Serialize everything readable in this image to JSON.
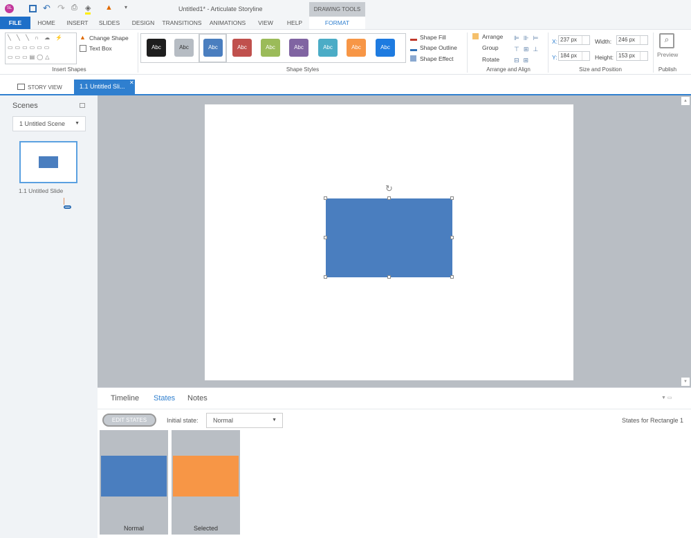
{
  "window": {
    "title": "Untitled1* -  Articulate Storyline",
    "logo": "SL",
    "contextual_group": "DRAWING TOOLS"
  },
  "tabs": [
    "FILE",
    "HOME",
    "INSERT",
    "SLIDES",
    "DESIGN",
    "TRANSITIONS",
    "ANIMATIONS",
    "VIEW",
    "HELP",
    "FORMAT"
  ],
  "ribbon": {
    "insert_shapes": {
      "label": "Insert Shapes",
      "change_shape": "Change Shape",
      "text_box": "Text Box"
    },
    "shape_styles": {
      "label": "Shape Styles",
      "swatch_text": "Abc",
      "swatches": [
        "#1e1e1e",
        "#b6bcc3",
        "#4a7ebf",
        "#c0504d",
        "#9bbb59",
        "#8064a2",
        "#4bacc6",
        "#f79646",
        "#1e7be0"
      ],
      "fill": "Shape Fill",
      "outline": "Shape Outline",
      "effect": "Shape Effect"
    },
    "arrange": {
      "label": "Arrange and Align",
      "arrange": "Arrange",
      "group": "Group",
      "rotate": "Rotate"
    },
    "size": {
      "label": "Size and Position",
      "x_label": "X:",
      "x": "237 px",
      "y_label": "Y:",
      "y": "184 px",
      "width_label": "Width:",
      "width": "246 px",
      "height_label": "Height:",
      "height": "153 px"
    },
    "publish": {
      "label": "Publish",
      "preview": "Preview"
    }
  },
  "doc_tabs": {
    "story_view": "STORY VIEW",
    "active": "1.1 Untitled Sli..."
  },
  "scenes": {
    "title": "Scenes",
    "selected": "1 Untitled Scene",
    "slide_label": "1.1 Untitled Slide"
  },
  "bottom": {
    "tabs": [
      "Timeline",
      "States",
      "Notes"
    ],
    "edit_states": "EDIT STATES",
    "initial_state_label": "Initial state:",
    "initial_state": "Normal",
    "states_for": "States for Rectangle 1",
    "states": [
      {
        "name": "Normal",
        "color": "#4a7ebf"
      },
      {
        "name": "Selected",
        "color": "#f79646"
      }
    ]
  }
}
